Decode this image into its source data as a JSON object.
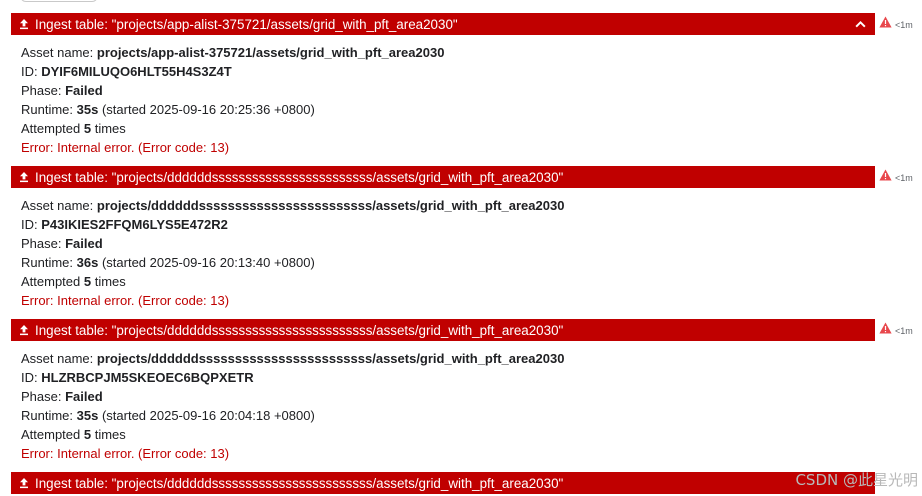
{
  "tasks": [
    {
      "title": "Ingest table: \"projects/app-alist-375721/assets/grid_with_pft_area2030\"",
      "status_time": "<1m",
      "asset_label": "Asset name: ",
      "asset_value": "projects/app-alist-375721/assets/grid_with_pft_area2030",
      "id_label": "ID: ",
      "id_value": "DYIF6MILUQO6HLT55H4S3Z4T",
      "phase_label": "Phase: ",
      "phase_value": "Failed",
      "runtime_label": "Runtime: ",
      "runtime_value": "35s",
      "runtime_started": " (started 2025-09-16 20:25:36 +0800)",
      "attempted_prefix": "Attempted ",
      "attempted_value": "5",
      "attempted_suffix": " times",
      "error": "Error: Internal error. (Error code: 13)"
    },
    {
      "title": "Ingest table: \"projects/ddddddssssssssssssssssssssssss/assets/grid_with_pft_area2030\"",
      "status_time": "<1m",
      "asset_label": "Asset name: ",
      "asset_value": "projects/ddddddssssssssssssssssssssssss/assets/grid_with_pft_area2030",
      "id_label": "ID: ",
      "id_value": "P43IKIES2FFQM6LYS5E472R2",
      "phase_label": "Phase: ",
      "phase_value": "Failed",
      "runtime_label": "Runtime: ",
      "runtime_value": "36s",
      "runtime_started": " (started 2025-09-16 20:13:40 +0800)",
      "attempted_prefix": "Attempted ",
      "attempted_value": "5",
      "attempted_suffix": " times",
      "error": "Error: Internal error. (Error code: 13)"
    },
    {
      "title": "Ingest table: \"projects/ddddddssssssssssssssssssssssss/assets/grid_with_pft_area2030\"",
      "status_time": "<1m",
      "asset_label": "Asset name: ",
      "asset_value": "projects/ddddddssssssssssssssssssssssss/assets/grid_with_pft_area2030",
      "id_label": "ID: ",
      "id_value": "HLZRBCPJM5SKEOEC6BQPXETR",
      "phase_label": "Phase: ",
      "phase_value": "Failed",
      "runtime_label": "Runtime: ",
      "runtime_value": "35s",
      "runtime_started": " (started 2025-09-16 20:04:18 +0800)",
      "attempted_prefix": "Attempted ",
      "attempted_value": "5",
      "attempted_suffix": " times",
      "error": "Error: Internal error. (Error code: 13)"
    },
    {
      "title": "Ingest table: \"projects/ddddddssssssssssssssssssssssss/assets/grid_with_pft_area2030\""
    }
  ],
  "watermark": "CSDN @此星光明",
  "colors": {
    "header_bg": "#c00000",
    "error_text": "#c00000",
    "warn_icon": "#e8474c"
  },
  "icons": {
    "header_left": "upload-icon",
    "header_right": "chevron-up-icon",
    "status": "warning-icon"
  }
}
